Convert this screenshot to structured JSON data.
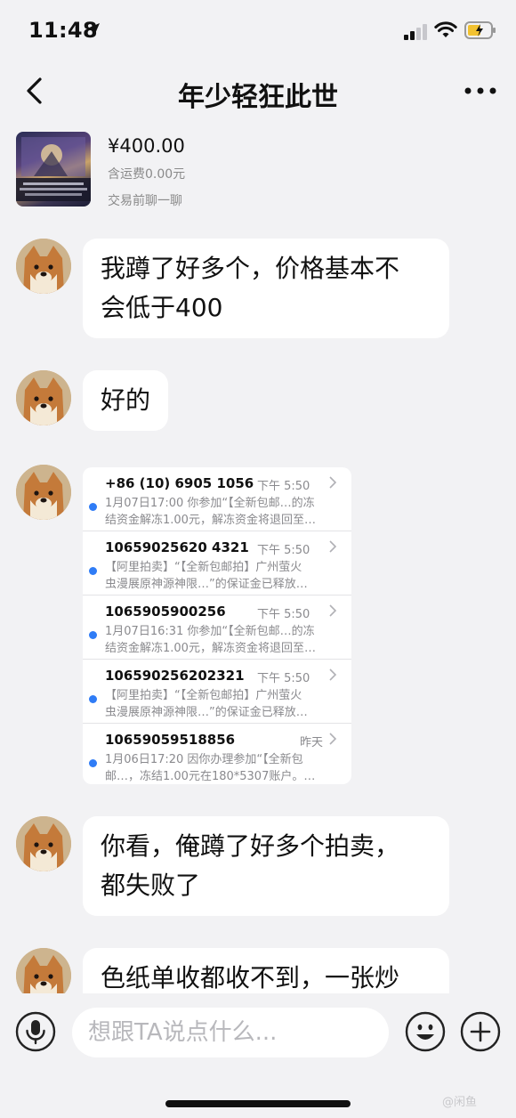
{
  "status_bar": {
    "time": "11:48"
  },
  "nav": {
    "title": "年少轻狂此世"
  },
  "product": {
    "price": "¥400.00",
    "shipping": "含运费0.00元",
    "chat_hint": "交易前聊一聊"
  },
  "messages": [
    {
      "type": "text",
      "lines": [
        "我蹲了好多个，价格基本不",
        "会低于400"
      ]
    },
    {
      "type": "text",
      "lines": [
        "好的"
      ]
    },
    {
      "type": "image",
      "sms_list": [
        {
          "sender": "+86 (10) 6905 1056",
          "time": "下午 5:50",
          "line1": "1月07日17:00 你参加“【全新包邮…的冻",
          "line2": "结资金解冻1.00元，解冻资金将退回至…"
        },
        {
          "sender": "10659025620 4321",
          "time": "下午 5:50",
          "line1": "【阿里拍卖】“【全新包邮拍】广州萤火",
          "line2": "虫漫展原神源神限…”的保证金已释放…"
        },
        {
          "sender": "1065905900256",
          "time": "下午 5:50",
          "line1": "1月07日16:31 你参加“【全新包邮…的冻",
          "line2": "结资金解冻1.00元，解冻资金将退回至…"
        },
        {
          "sender": "106590256202321",
          "time": "下午 5:50",
          "line1": "【阿里拍卖】“【全新包邮拍】广州萤火",
          "line2": "虫漫展原神源神限…”的保证金已释放…"
        },
        {
          "sender": "10659059518856",
          "time": "昨天",
          "line1": "1月06日17:20 因你办理参加“【全新包",
          "line2": "邮…，冻结1.00元在180*5307账户。…"
        }
      ]
    },
    {
      "type": "text",
      "lines": [
        "你看，俺蹲了好多个拍卖，",
        "都失败了"
      ]
    },
    {
      "type": "text",
      "lines": [
        "色纸单收都收不到，一张炒"
      ]
    }
  ],
  "input": {
    "placeholder": "想跟TA说点什么..."
  },
  "watermark": "@闲鱼"
}
